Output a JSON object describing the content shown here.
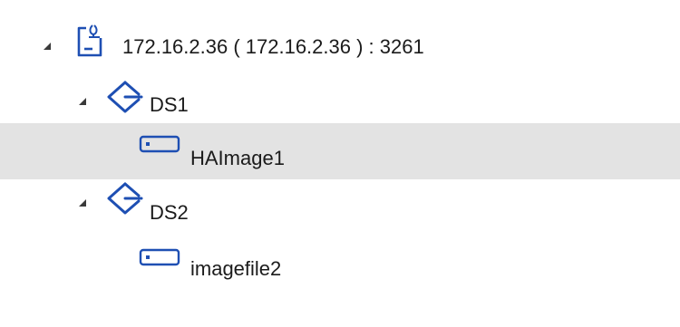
{
  "tree": {
    "target": {
      "label": "172.16.2.36 ( 172.16.2.36 ) : 3261",
      "icon": "server-target-icon",
      "expanded": true
    },
    "datastores": [
      {
        "label": "DS1",
        "icon": "datastore-icon",
        "expanded": true,
        "images": [
          {
            "label": "HAImage1",
            "icon": "disk-image-icon",
            "selected": true
          }
        ]
      },
      {
        "label": "DS2",
        "icon": "datastore-icon",
        "expanded": true,
        "images": [
          {
            "label": "imagefile2",
            "icon": "disk-image-icon",
            "selected": false
          }
        ]
      }
    ],
    "colors": {
      "icon_blue": "#1e4fb3",
      "selection_bg": "#e3e3e3"
    }
  }
}
